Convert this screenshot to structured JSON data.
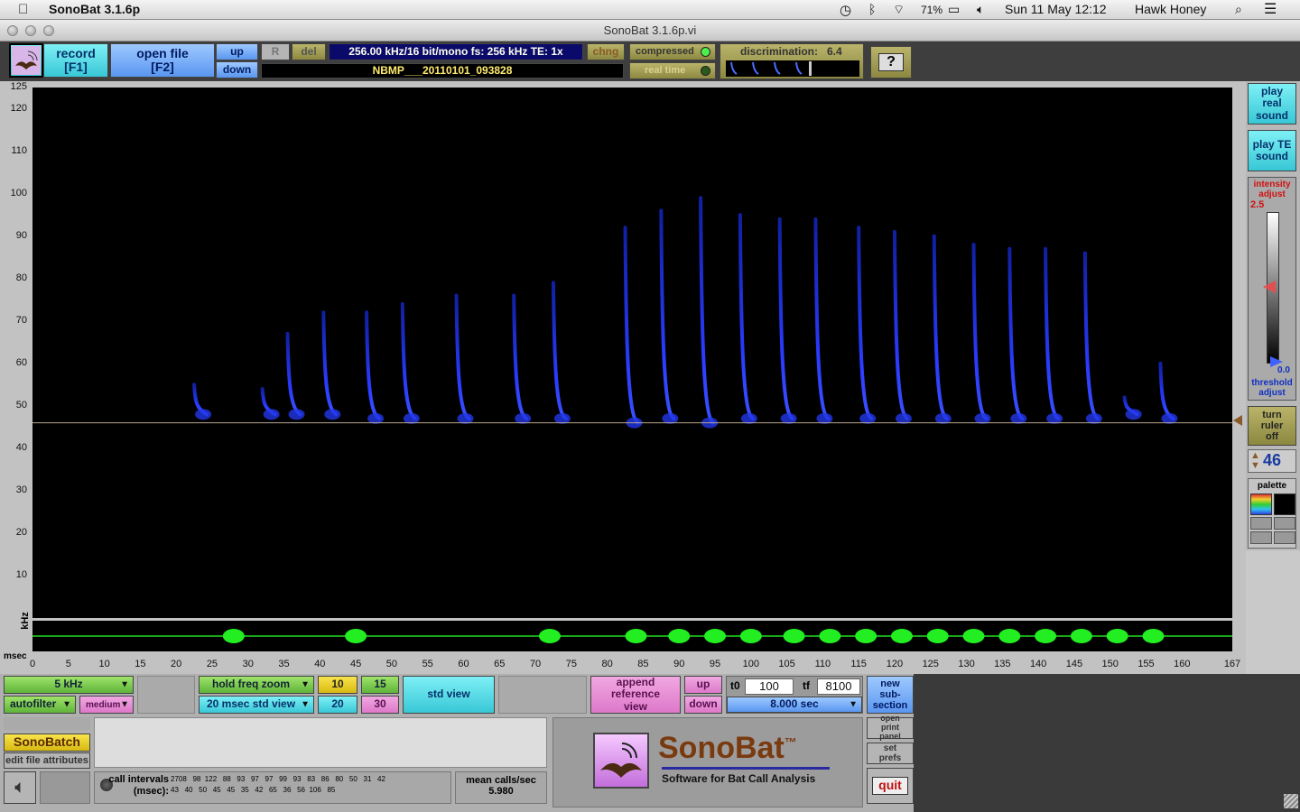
{
  "menubar": {
    "app": "SonoBat 3.1.6p",
    "battery": "71%",
    "datetime": "Sun 11 May  12:12",
    "user": "Hawk Honey"
  },
  "window": {
    "title": "SonoBat 3.1.6p.vi"
  },
  "toolbar": {
    "record": "record",
    "record_key": "[F1]",
    "open_file": "open file",
    "open_key": "[F2]",
    "up": "up",
    "down": "down",
    "r": "R",
    "del": "del",
    "info": "256.00 kHz/16 bit/mono   fs: 256 kHz   TE:  1x",
    "filename": "NBMP___20110101_093828",
    "chng": "chng",
    "compressed": "compressed",
    "realtime": "real time",
    "discrimination_label": "discrimination:",
    "discrimination_value": "6.4",
    "help": "?"
  },
  "yaxis": {
    "unit": "kHz",
    "ticks": [
      "125",
      "120",
      "110",
      "100",
      "90",
      "80",
      "70",
      "60",
      "50",
      "40",
      "30",
      "20",
      "10"
    ]
  },
  "xaxis": {
    "unit": "msec",
    "ticks": [
      "0",
      "5",
      "10",
      "15",
      "20",
      "25",
      "30",
      "35",
      "40",
      "45",
      "50",
      "55",
      "60",
      "65",
      "70",
      "75",
      "80",
      "85",
      "90",
      "95",
      "100",
      "105",
      "110",
      "115",
      "120",
      "125",
      "130",
      "135",
      "140",
      "145",
      "150",
      "155",
      "160",
      "167"
    ]
  },
  "right_panel": {
    "play_real": "play real sound",
    "play_te": "play TE sound",
    "intensity": "intensity adjust",
    "intensity_value": "2.5",
    "threshold_value": "0.0",
    "threshold": "threshold adjust",
    "ruler": "turn ruler off",
    "ruler_value": "46",
    "palette": "palette"
  },
  "bottom": {
    "freq_step": "5 kHz",
    "autofilter": "autofilter",
    "medium": "medium",
    "hold_freq_zoom": "hold freq zoom",
    "std_view_select": "20 msec std view",
    "z10": "10",
    "z15": "15",
    "z20": "20",
    "z30": "30",
    "std_view": "std view",
    "append": "append reference view",
    "up": "up",
    "down": "down",
    "t0_label": "t0",
    "t0_value": "100",
    "tf_label": "tf",
    "tf_value": "8100",
    "duration": "8.000 sec",
    "new_sub": "new sub- section",
    "sonobatch": "SonoBatch",
    "edit_attrs": "edit file attributes",
    "intervals_label": "call intervals (msec):",
    "intervals_row1": "2708   98  122   88   93   97   97   99   93   83   86   80   50   31   42",
    "intervals_row2": "43   40   50   45   45   35   42   65   36   56  106   85",
    "mean_label": "mean calls/sec",
    "mean_value": "5.980",
    "logo_name": "SonoBat",
    "logo_tm": "™",
    "logo_tagline": "Software for Bat Call Analysis",
    "open_print": "open print panel",
    "set_prefs": "set prefs",
    "quit": "quit"
  },
  "chart_data": {
    "type": "spectrogram",
    "xlabel": "msec",
    "ylabel": "kHz",
    "xlim": [
      0,
      167
    ],
    "ylim": [
      0,
      125
    ],
    "ruler_khz": 46,
    "calls": [
      {
        "t": 22.5,
        "f_start": 55,
        "f_end": 48
      },
      {
        "t": 32,
        "f_start": 54,
        "f_end": 48
      },
      {
        "t": 35.5,
        "f_start": 67,
        "f_end": 48
      },
      {
        "t": 40.5,
        "f_start": 72,
        "f_end": 48
      },
      {
        "t": 46.5,
        "f_start": 72,
        "f_end": 47
      },
      {
        "t": 51.5,
        "f_start": 74,
        "f_end": 47
      },
      {
        "t": 59,
        "f_start": 76,
        "f_end": 47
      },
      {
        "t": 67,
        "f_start": 76,
        "f_end": 47
      },
      {
        "t": 72.5,
        "f_start": 79,
        "f_end": 47
      },
      {
        "t": 82.5,
        "f_start": 92,
        "f_end": 46
      },
      {
        "t": 87.5,
        "f_start": 96,
        "f_end": 47
      },
      {
        "t": 93,
        "f_start": 99,
        "f_end": 46
      },
      {
        "t": 98.5,
        "f_start": 95,
        "f_end": 47
      },
      {
        "t": 104,
        "f_start": 94,
        "f_end": 47
      },
      {
        "t": 109,
        "f_start": 94,
        "f_end": 47
      },
      {
        "t": 115,
        "f_start": 92,
        "f_end": 47
      },
      {
        "t": 120,
        "f_start": 91,
        "f_end": 47
      },
      {
        "t": 125.5,
        "f_start": 90,
        "f_end": 47
      },
      {
        "t": 131,
        "f_start": 88,
        "f_end": 47
      },
      {
        "t": 136,
        "f_start": 87,
        "f_end": 47
      },
      {
        "t": 141,
        "f_start": 87,
        "f_end": 47
      },
      {
        "t": 146.5,
        "f_start": 86,
        "f_end": 47
      },
      {
        "t": 152,
        "f_start": 52,
        "f_end": 48
      },
      {
        "t": 157,
        "f_start": 60,
        "f_end": 47
      }
    ],
    "waveform_bursts": [
      28,
      45,
      72,
      84,
      90,
      95,
      100,
      106,
      111,
      116,
      121,
      126,
      131,
      136,
      141,
      146,
      151,
      156
    ]
  }
}
